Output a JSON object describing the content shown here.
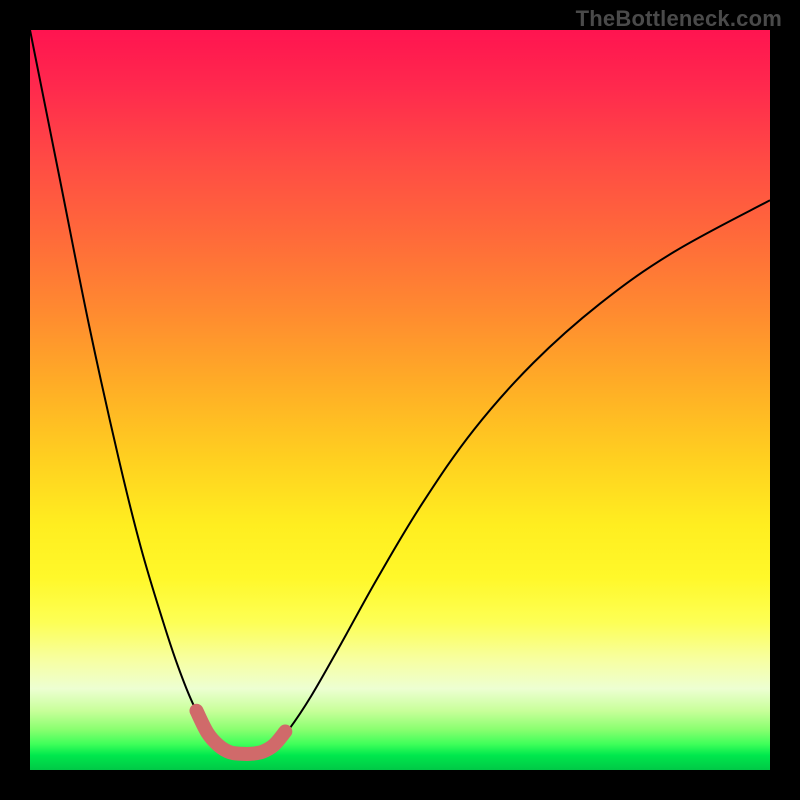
{
  "watermark": "TheBottleneck.com",
  "chart_data": {
    "type": "line",
    "title": "",
    "xlabel": "",
    "ylabel": "",
    "xlim": [
      0,
      100
    ],
    "ylim": [
      0,
      100
    ],
    "series": [
      {
        "name": "curve",
        "x": [
          0,
          4,
          8,
          12,
          15,
          18,
          20,
          22,
          24,
          25.5,
          27,
          28.5,
          30,
          31.5,
          33,
          35,
          38,
          42,
          47,
          53,
          60,
          68,
          77,
          87,
          100
        ],
        "y": [
          100,
          80,
          60,
          42,
          30,
          20,
          14,
          9,
          5.5,
          3.5,
          2.5,
          2.2,
          2.2,
          2.5,
          3.3,
          5.5,
          10,
          17,
          26,
          36,
          46,
          55,
          63,
          70,
          77
        ]
      },
      {
        "name": "emphasis-segment",
        "x": [
          22.5,
          24,
          25.5,
          27,
          28.5,
          30,
          31.5,
          33,
          34.5
        ],
        "y": [
          8,
          5,
          3.3,
          2.4,
          2.2,
          2.2,
          2.5,
          3.4,
          5.2
        ]
      }
    ],
    "colors": {
      "curve": "#000000",
      "emphasis": "#d06a6a",
      "background_top": "#ff1450",
      "background_mid": "#ffee20",
      "background_bottom": "#00c846",
      "watermark": "#4a4a4a"
    }
  }
}
